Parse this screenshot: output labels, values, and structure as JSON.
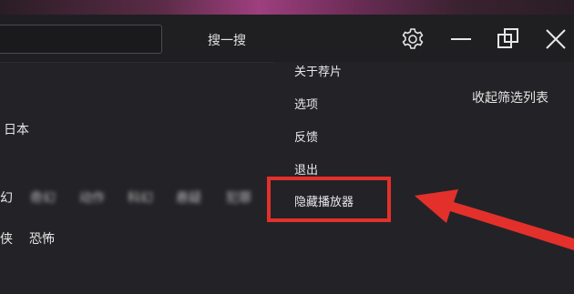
{
  "header": {
    "search_button": "搜一搜"
  },
  "icons": {
    "settings": "gear-icon",
    "minimize": "minimize-icon",
    "maximize": "maximize-icon",
    "close": "close-icon"
  },
  "filters": {
    "collapse_label": "收起筛选列表",
    "region_value": "日本",
    "genre_fragments": [
      "幻",
      "奇幻",
      "动作",
      "科幻",
      "悬疑",
      "犯罪"
    ],
    "row3": [
      "侠",
      "恐怖"
    ]
  },
  "settings_menu": {
    "items": [
      "关于荐片",
      "选项",
      "反馈",
      "退出",
      "隐藏播放器"
    ]
  },
  "colors": {
    "highlight": "#e3302b",
    "background": "#232327"
  }
}
